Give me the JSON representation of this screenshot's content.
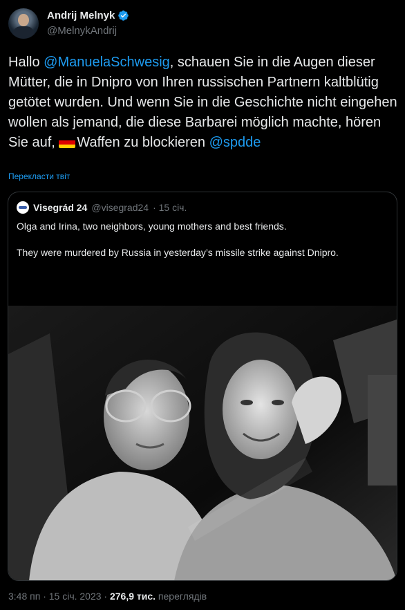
{
  "author": {
    "name": "Andrij Melnyk",
    "handle": "@MelnykAndrij"
  },
  "tweet": {
    "text_before_mention1": "Hallo ",
    "mention1": "@ManuelaSchwesig",
    "text_after_mention1": ", schauen Sie in die Augen dieser Mütter, die in Dnipro von Ihren russischen Partnern kaltblütig getötet wurden. Und wenn Sie in die Geschichte nicht eingehen wollen als jemand, die diese Barbarei möglich machte, hören Sie auf, ",
    "text_after_flag": "Waffen zu blockieren ",
    "mention2": "@spdde",
    "flag_colors": [
      "#000000",
      "#dd0000",
      "#ffce00"
    ]
  },
  "translate_label": "Перекласти твіт",
  "quoted": {
    "name": "Visegrád 24",
    "handle": "@visegrad24",
    "date": "· 15 січ.",
    "line1": "Olga and Irina, two neighbors, young mothers and best friends.",
    "line2": "They were murdered by Russia in yesterday’s missile strike against Dnipro."
  },
  "footer": {
    "time_date": "3:48 пп · 15 січ. 2023 · ",
    "views_count": "276,9 тис.",
    "views_label": " переглядів"
  },
  "colors": {
    "background": "#000000",
    "link": "#1d9bf0",
    "secondary_text": "#71767b",
    "border": "#2f3336",
    "verified": "#1d9bf0"
  }
}
